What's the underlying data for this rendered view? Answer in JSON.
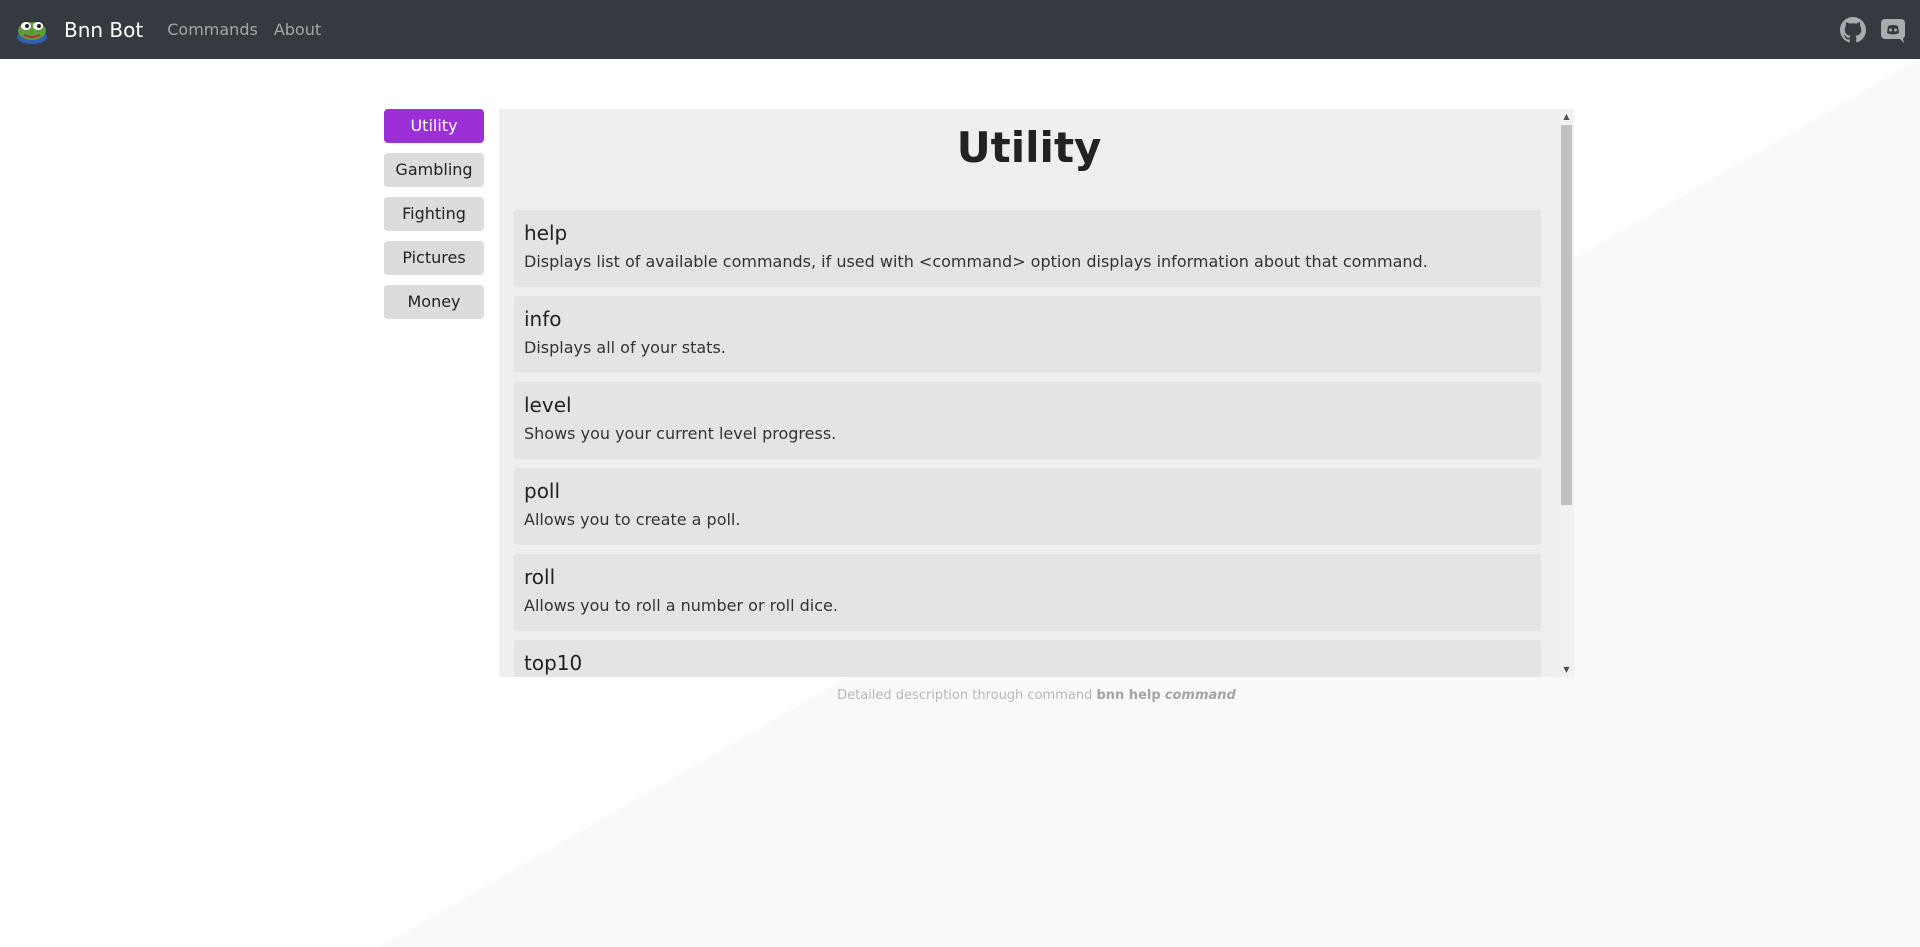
{
  "colors": {
    "navbar_bg": "#343a40",
    "active_accent": "#9b30d9",
    "panel_bg": "#efefef",
    "card_bg": "#e4e4e4"
  },
  "navbar": {
    "brand": "Bnn Bot",
    "logo_icon": "frog-logo-icon",
    "links": [
      "Commands",
      "About"
    ],
    "right_icons": [
      "github-icon",
      "discord-icon"
    ]
  },
  "sidebar": {
    "categories": [
      "Utility",
      "Gambling",
      "Fighting",
      "Pictures",
      "Money"
    ],
    "active": "Utility"
  },
  "panel": {
    "title": "Utility",
    "commands": [
      {
        "name": "help",
        "description": "Displays list of available commands, if used with <command> option displays information about that command."
      },
      {
        "name": "info",
        "description": "Displays all of your stats."
      },
      {
        "name": "level",
        "description": "Shows you your current level progress."
      },
      {
        "name": "poll",
        "description": "Allows you to create a poll."
      },
      {
        "name": "roll",
        "description": "Allows you to roll a number or roll dice."
      },
      {
        "name": "top10",
        "description": ""
      }
    ]
  },
  "footer": {
    "prefix": "Detailed description through command",
    "command": "bnn help",
    "argument": "command"
  }
}
